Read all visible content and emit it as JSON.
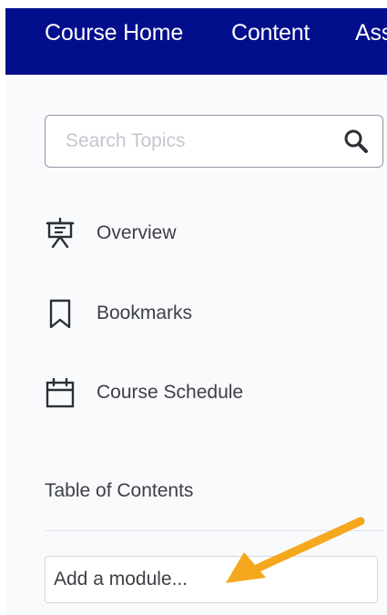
{
  "navbar": {
    "items": [
      {
        "label": "Course Home"
      },
      {
        "label": "Content"
      },
      {
        "label": "Ass"
      }
    ],
    "background": "#030e8c"
  },
  "search": {
    "placeholder": "Search Topics",
    "value": "",
    "icon": "search-icon"
  },
  "sidebar": {
    "items": [
      {
        "label": "Overview",
        "icon": "presentation-board-icon"
      },
      {
        "label": "Bookmarks",
        "icon": "bookmark-icon"
      },
      {
        "label": "Course Schedule",
        "icon": "calendar-icon"
      }
    ],
    "toc_heading": "Table of Contents",
    "add_module_label": "Add a module..."
  },
  "annotation": {
    "arrow_color": "#f5a71d",
    "icon": "arrow-pointer-icon"
  }
}
